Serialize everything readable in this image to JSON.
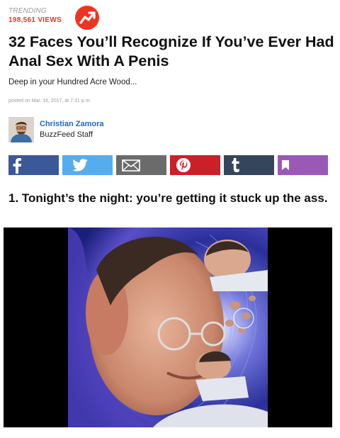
{
  "trending": {
    "label": "TRENDING",
    "views": "198,561 VIEWS"
  },
  "article": {
    "title": "32 Faces You’ll Recognize If You’ve Ever Had Anal Sex With A Penis",
    "subtitle": "Deep in your Hundred Acre Wood...",
    "posted": "posted on Mar. 16, 2017, at 7:31 p.m."
  },
  "author": {
    "name": "Christian Zamora",
    "role": "BuzzFeed Staff"
  },
  "share": {
    "buttons": [
      {
        "network": "facebook",
        "icon": "facebook-icon",
        "color": "#3b5998"
      },
      {
        "network": "twitter",
        "icon": "twitter-icon",
        "color": "#55acee"
      },
      {
        "network": "email",
        "icon": "mail-icon",
        "color": "#696969"
      },
      {
        "network": "pinterest",
        "icon": "pinterest-icon",
        "color": "#cb2027"
      },
      {
        "network": "tumblr",
        "icon": "tumblr-icon",
        "color": "#35465c"
      },
      {
        "network": "bookmark",
        "icon": "bookmark-icon",
        "color": "#9b59b6"
      }
    ]
  },
  "item": {
    "title": "1. Tonight’s the night: you’re getting it stuck up the ass."
  }
}
